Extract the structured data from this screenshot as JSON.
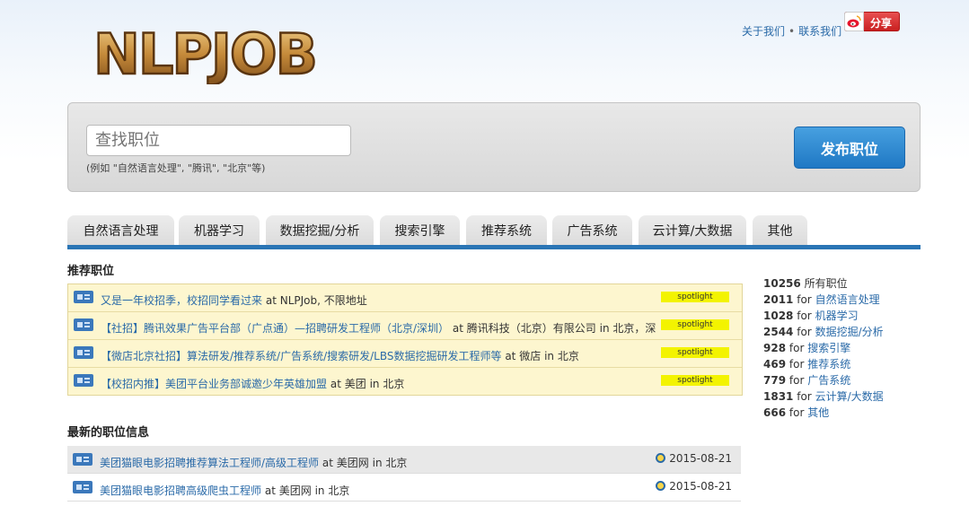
{
  "header": {
    "logo_text": "NLPJOB",
    "about_label": "关于我们",
    "contact_label": "联系我们",
    "share_label": "分享"
  },
  "search": {
    "placeholder": "查找职位",
    "hint": "(例如 \"自然语言处理\", \"腾讯\", \"北京\"等)",
    "post_label": "发布职位"
  },
  "tabs": [
    {
      "label": "自然语言处理"
    },
    {
      "label": "机器学习"
    },
    {
      "label": "数据挖掘/分析"
    },
    {
      "label": "搜索引擎"
    },
    {
      "label": "推荐系统"
    },
    {
      "label": "广告系统"
    },
    {
      "label": "云计算/大数据"
    },
    {
      "label": "其他"
    }
  ],
  "featured": {
    "title": "推荐职位",
    "spotlight_label": "spotlight",
    "items": [
      {
        "title": "又是一年校招季，校招同学看过来",
        "at": "at",
        "company": "NLPJob, 不限地址",
        "in": "",
        "location": ""
      },
      {
        "title": "【社招】腾讯效果广告平台部（广点通）—招聘研发工程师（北京/深圳）",
        "at": "at",
        "company": "腾讯科技（北京）有限公司",
        "in": "in",
        "location": "北京，深"
      },
      {
        "title": "【微店北京社招】算法研发/推荐系统/广告系统/搜索研发/LBS数据挖掘研发工程师等",
        "at": "at",
        "company": "微店",
        "in": "in",
        "location": "北京"
      },
      {
        "title": "【校招内推】美团平台业务部诚邀少年英雄加盟",
        "at": "at",
        "company": "美团",
        "in": "in",
        "location": "北京"
      }
    ]
  },
  "latest": {
    "title": "最新的职位信息",
    "items": [
      {
        "title": "美团猫眼电影招聘推荐算法工程师/高级工程师",
        "at": "at",
        "company": "美团网",
        "in": "in",
        "location": "北京",
        "date": "2015-08-21"
      },
      {
        "title": "美团猫眼电影招聘高级爬虫工程师",
        "at": "at",
        "company": "美团网",
        "in": "in",
        "location": "北京",
        "date": "2015-08-21"
      }
    ]
  },
  "stats": {
    "all": {
      "count": "10256",
      "label": "所有职位"
    },
    "items": [
      {
        "count": "2011",
        "for": "for",
        "label": "自然语言处理"
      },
      {
        "count": "1028",
        "for": "for",
        "label": "机器学习"
      },
      {
        "count": "2544",
        "for": "for",
        "label": "数据挖掘/分析"
      },
      {
        "count": "928",
        "for": "for",
        "label": "搜索引擎"
      },
      {
        "count": "469",
        "for": "for",
        "label": "推荐系统"
      },
      {
        "count": "779",
        "for": "for",
        "label": "广告系统"
      },
      {
        "count": "1831",
        "for": "for",
        "label": "云计算/大数据"
      },
      {
        "count": "666",
        "for": "for",
        "label": "其他"
      }
    ]
  },
  "colors": {
    "accent": "#2a75b5",
    "link": "#2a6aa8",
    "featured_bg": "#fdf6cf",
    "spotlight": "#f3f300",
    "share": "#d02828"
  },
  "icons": {
    "job": "job-badge-icon",
    "clock": "clock-icon",
    "weibo": "weibo-icon"
  }
}
